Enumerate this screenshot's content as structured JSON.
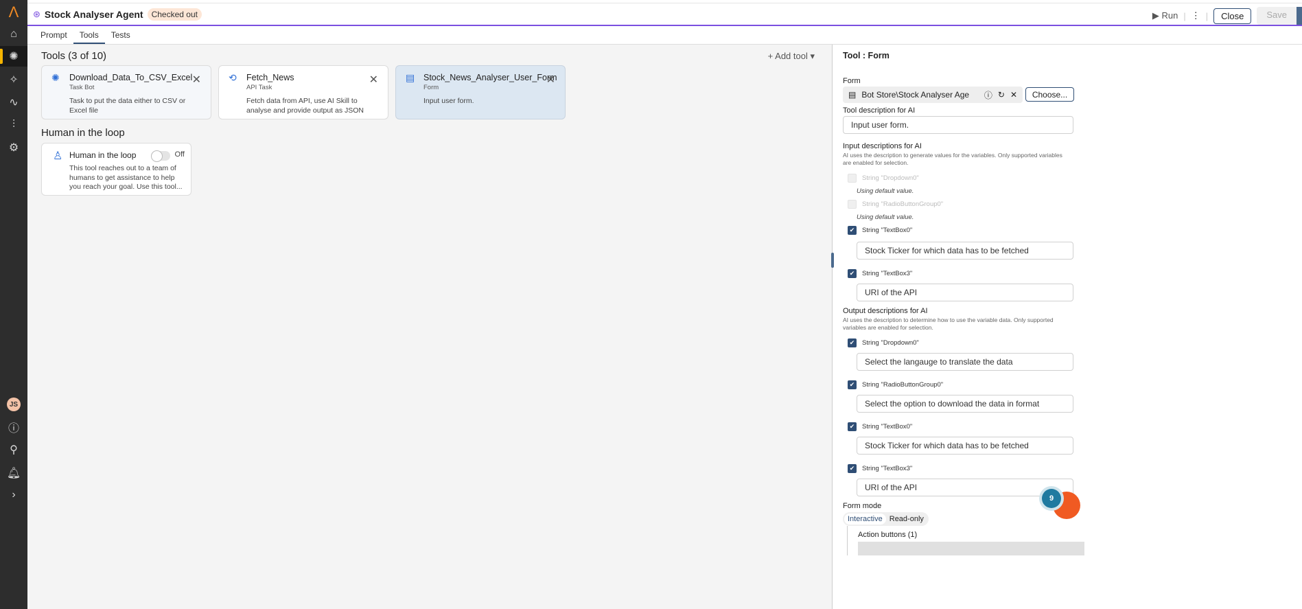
{
  "header": {
    "title": "Stock Analyser Agent",
    "status": "Checked out",
    "run": "Run",
    "more": "⋮",
    "close": "Close",
    "save": "Save"
  },
  "tabs": [
    "Prompt",
    "Tools",
    "Tests"
  ],
  "tools": {
    "heading": "Tools (3 of 10)",
    "add": "Add tool",
    "cards": [
      {
        "name": "Download_Data_To_CSV_Excel",
        "type": "Task Bot",
        "desc": "Task to put the data either to CSV or Excel file"
      },
      {
        "name": "Fetch_News",
        "type": "API Task",
        "desc": "Fetch data from API, use AI Skill to analyse and provide output as JSON"
      },
      {
        "name": "Stock_News_Analyser_User_Form",
        "type": "Form",
        "desc": "Input user form."
      }
    ]
  },
  "hitl": {
    "heading": "Human in the loop",
    "name": "Human in the loop",
    "toggle": "Off",
    "desc": "This tool reaches out to a team of humans to get assistance to help you reach your goal. Use this tool..."
  },
  "panel": {
    "title": "Tool : Form",
    "form_label": "Form",
    "form_value": "Bot Store\\Stock Analyser Age",
    "choose": "Choose...",
    "tool_desc_label": "Tool description for AI",
    "tool_desc": "Input user form.",
    "input_label": "Input descriptions for AI",
    "input_help": "AI uses the description to generate values for the variables. Only supported variables are enabled for selection.",
    "default_text": "Using default value.",
    "inputs": [
      {
        "label": "String \"Dropdown0\""
      },
      {
        "label": "String \"RadioButtonGroup0\""
      },
      {
        "label": "String \"TextBox0\"",
        "value": "Stock Ticker for which data has to be fetched"
      },
      {
        "label": "String \"TextBox3\"",
        "value": "URI of the API"
      }
    ],
    "output_label": "Output descriptions for AI",
    "output_help": "AI uses the description to determine how to use the variable data. Only supported variables are enabled for selection.",
    "outputs": [
      {
        "label": "String \"Dropdown0\"",
        "value": "Select the langauge to translate the data"
      },
      {
        "label": "String \"RadioButtonGroup0\"",
        "value": "Select the option to download the data in format"
      },
      {
        "label": "String \"TextBox0\"",
        "value": "Stock Ticker for which data has to be fetched"
      },
      {
        "label": "String \"TextBox3\"",
        "value": "URI of the API"
      }
    ],
    "form_mode_label": "Form mode",
    "modes": [
      "Interactive",
      "Read-only"
    ],
    "actions_label": "Action buttons (1)"
  },
  "user_initials": "JS",
  "notification_count": "9",
  "colors": {
    "accent": "#7b4fe0",
    "primary": "#2f4e75",
    "fab": "#f05a22"
  }
}
